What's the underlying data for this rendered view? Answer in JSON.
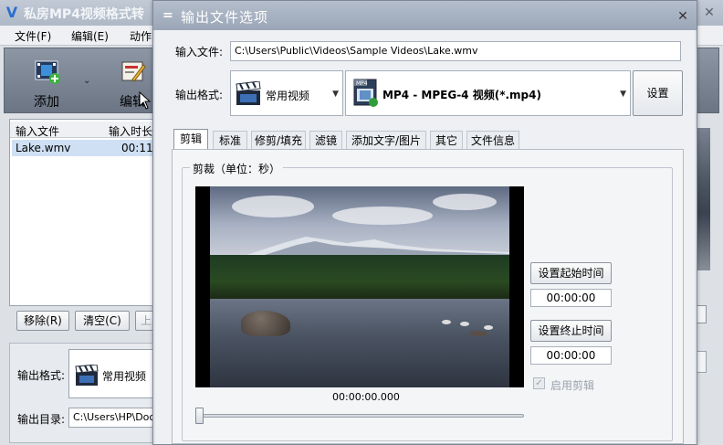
{
  "main_window": {
    "title": "私房MP4视频格式转",
    "menu": [
      "文件(F)",
      "编辑(E)",
      "动作("
    ],
    "toolbar": {
      "add_label": "添加",
      "edit_label": "编辑"
    },
    "file_list": {
      "headers": [
        "输入文件",
        "输入时长"
      ],
      "rows": [
        {
          "name": "Lake.wmv",
          "duration": "00:11"
        }
      ]
    },
    "buttons": {
      "remove": "移除(R)",
      "clear": "清空(C)",
      "up": "上"
    },
    "output_format_label": "输出格式:",
    "output_format_value": "常用视频",
    "output_dir_label": "输出目录:",
    "output_dir_value": "C:\\Users\\HP\\Docum"
  },
  "dialog": {
    "title": "输出文件选项",
    "input_file_label": "输入文件:",
    "input_file_value": "C:\\Users\\Public\\Videos\\Sample Videos\\Lake.wmv",
    "output_format_label": "输出格式:",
    "category_value": "常用视频",
    "format_value": "MP4 - MPEG-4 视频(*.mp4)",
    "settings_button": "设置",
    "tabs": [
      "剪辑",
      "标准",
      "修剪/填充",
      "滤镜",
      "添加文字/图片",
      "其它",
      "文件信息"
    ],
    "active_tab": "剪辑",
    "crop_group_title": "剪裁（单位：秒）",
    "set_start_button": "设置起始时间",
    "start_time": "00:00:00",
    "set_end_button": "设置终止时间",
    "end_time": "00:00:00",
    "enable_clip_label": "启用剪辑",
    "enable_clip_checked": true,
    "preview_timecode": "00:00:00.000",
    "preview_position": 0.0
  }
}
